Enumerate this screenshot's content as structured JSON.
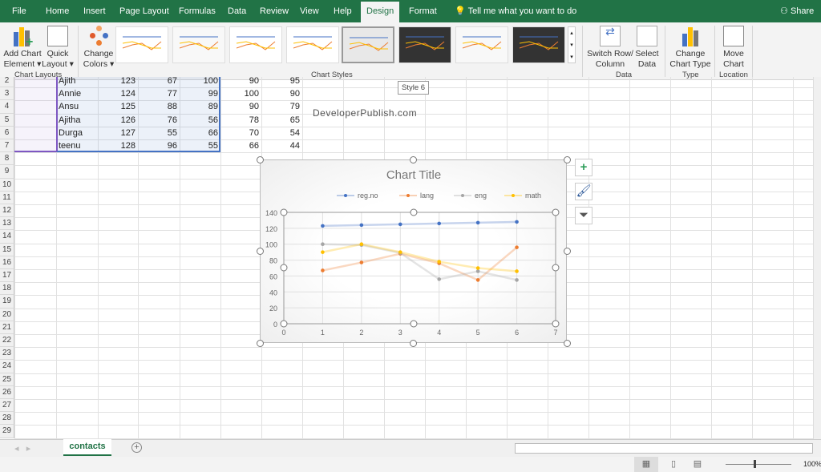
{
  "menu_tabs": [
    "File",
    "Home",
    "Insert",
    "Page Layout",
    "Formulas",
    "Data",
    "Review",
    "View",
    "Help",
    "Design",
    "Format"
  ],
  "active_tab": "Design",
  "tell_me": "Tell me what you want to do",
  "share": "Share",
  "ribbon": {
    "add_chart_element": [
      "Add Chart",
      "Element ▾"
    ],
    "quick_layout": [
      "Quick",
      "Layout ▾"
    ],
    "change_colors": [
      "Change",
      "Colors ▾"
    ],
    "chart_layouts_label": "Chart Layouts",
    "chart_styles_label": "Chart Styles",
    "switch_row_column": [
      "Switch Row/",
      "Column"
    ],
    "select_data": [
      "Select",
      "Data"
    ],
    "data_label": "Data",
    "change_chart_type": [
      "Change",
      "Chart Type"
    ],
    "type_label": "Type",
    "move_chart": [
      "Move",
      "Chart"
    ],
    "location_label": "Location",
    "tooltip": "Style 6"
  },
  "sheet": {
    "first_row": 2,
    "rows": [
      [
        "Ajith",
        "123",
        "67",
        "100",
        "90",
        "95"
      ],
      [
        "Annie",
        "124",
        "77",
        "99",
        "100",
        "90"
      ],
      [
        "Ansu",
        "125",
        "88",
        "89",
        "90",
        "79"
      ],
      [
        "Ajitha",
        "126",
        "76",
        "56",
        "78",
        "65"
      ],
      [
        "Durga",
        "127",
        "55",
        "66",
        "70",
        "54"
      ],
      [
        "teenu",
        "128",
        "96",
        "55",
        "66",
        "44"
      ]
    ],
    "last_row": 29
  },
  "watermark": "DeveloperPublish.com",
  "sheet_tab": "contacts",
  "zoom": "100%",
  "chart_data": {
    "type": "line",
    "title": "Chart Title",
    "x": [
      1,
      2,
      3,
      4,
      5,
      6
    ],
    "xlim": [
      0,
      7
    ],
    "ylim": [
      0,
      140
    ],
    "xticks": [
      "0",
      "1",
      "2",
      "3",
      "4",
      "5",
      "6",
      "7"
    ],
    "yticks": [
      "0",
      "20",
      "40",
      "60",
      "80",
      "100",
      "120",
      "140"
    ],
    "grid": true,
    "legend": "top",
    "series": [
      {
        "name": "reg.no",
        "values": [
          123,
          124,
          125,
          126,
          127,
          128
        ],
        "color": "#4472c4"
      },
      {
        "name": "lang",
        "values": [
          67,
          77,
          88,
          76,
          55,
          96
        ],
        "color": "#ed7d31"
      },
      {
        "name": "eng",
        "values": [
          100,
          99,
          89,
          56,
          66,
          55
        ],
        "color": "#a5a5a5"
      },
      {
        "name": "math",
        "values": [
          90,
          100,
          90,
          78,
          70,
          66
        ],
        "color": "#ffc000"
      }
    ]
  },
  "colors": {
    "brand": "#217346"
  }
}
